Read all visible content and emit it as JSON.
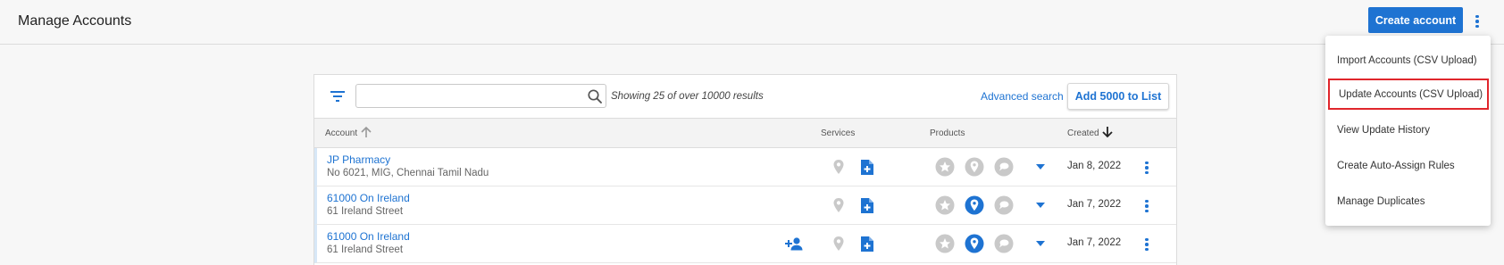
{
  "header": {
    "title": "Manage Accounts",
    "create_label": "Create account"
  },
  "toolbar": {
    "search_value": "",
    "search_placeholder": "",
    "result_text": "Showing 25 of over 10000 results",
    "advanced_search": "Advanced search",
    "add_button": "Add 5000 to List"
  },
  "table": {
    "columns": [
      "Account",
      "Services",
      "Products",
      "Created"
    ],
    "sort": {
      "account": "ascending-inactive",
      "created": "descending"
    },
    "rows": [
      {
        "name": "JP Pharmacy",
        "address": "No 6021, MIG, Chennai Tamil Nadu",
        "created": "Jan 8, 2022",
        "has_add_user": false,
        "product_pin_active": false
      },
      {
        "name": "61000 On Ireland",
        "address": "61 Ireland Street",
        "created": "Jan 7, 2022",
        "has_add_user": false,
        "product_pin_active": true
      },
      {
        "name": "61000 On Ireland",
        "address": "61 Ireland Street",
        "created": "Jan 7, 2022",
        "has_add_user": true,
        "product_pin_active": true
      }
    ]
  },
  "menu": {
    "items": [
      "Import Accounts (CSV Upload)",
      "Update Accounts (CSV Upload)",
      "View Update History",
      "Create Auto-Assign Rules",
      "Manage Duplicates"
    ],
    "highlighted_index": 1
  },
  "icons": {
    "filter": "filter-icon",
    "search": "search-icon",
    "more": "kebab-icon",
    "add_user": "add-user-icon",
    "location": "location-pin-icon",
    "document": "document-plus-icon",
    "star": "star-icon",
    "chat": "chat-bubble-icon",
    "caret": "caret-down-icon"
  },
  "colors": {
    "accent": "#1e73d2",
    "highlight_border": "#e0262c",
    "inactive_icon": "#c9c9c9"
  }
}
